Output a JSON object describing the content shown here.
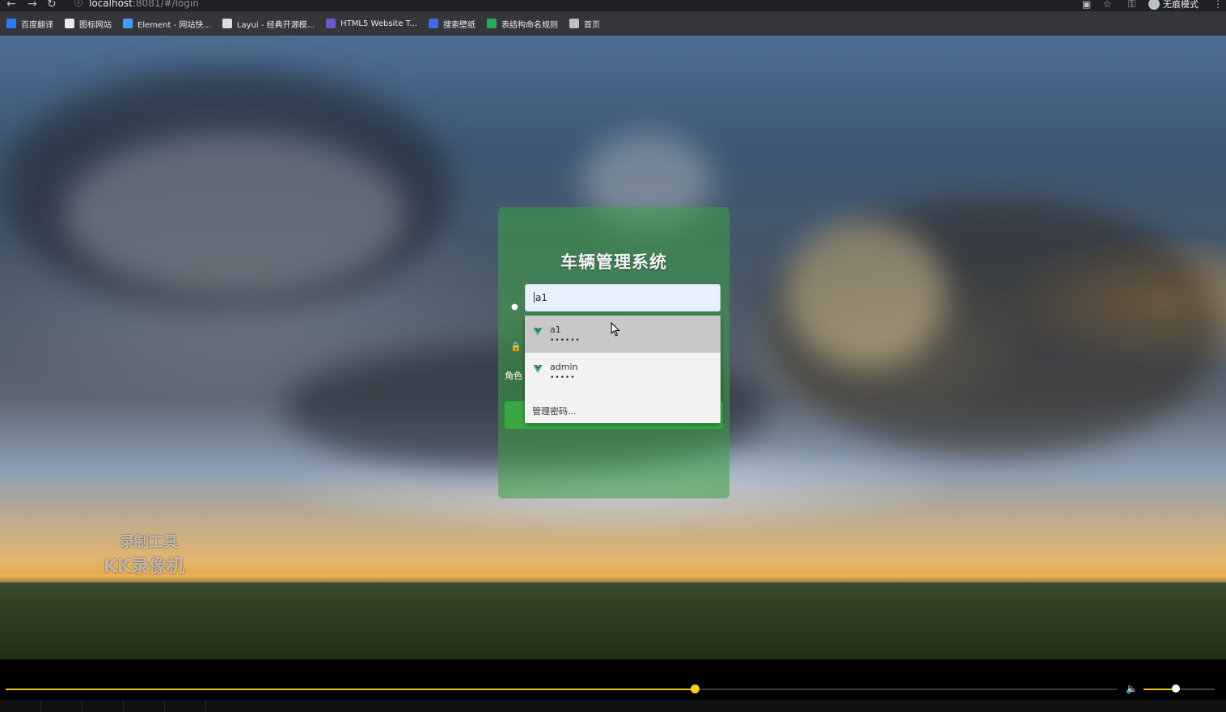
{
  "browser": {
    "url_host": "localhost",
    "url_rest": ":8081/#/login",
    "incognito_label": "无痕模式",
    "bookmarks": [
      {
        "label": "百度翻译",
        "color": "#2f7cf6"
      },
      {
        "label": "图标网站",
        "color": "#e8eaed"
      },
      {
        "label": "Element - 网站快...",
        "color": "#409eff"
      },
      {
        "label": "Layui - 经典开源模...",
        "color": "#dddddd"
      },
      {
        "label": "HTML5 Website T...",
        "color": "#6a5acd"
      },
      {
        "label": "搜索壁纸",
        "color": "#3d6be0"
      },
      {
        "label": "表结构命名规则",
        "color": "#2aa855"
      },
      {
        "label": "首页",
        "color": "#c0c0c0"
      }
    ]
  },
  "login": {
    "title": "车辆管理系统",
    "username_value": "a1",
    "role_label": "角色"
  },
  "autofill": {
    "items": [
      {
        "user": "a1",
        "password_mask": "••••••"
      },
      {
        "user": "admin",
        "password_mask": "•••••"
      }
    ],
    "manage_label": "管理密码..."
  },
  "watermark": {
    "line1": "录制工具",
    "line2": "KK录像机"
  },
  "player": {
    "progress": 0.62,
    "volume": 0.45,
    "accent_color": "#e8c51c"
  }
}
